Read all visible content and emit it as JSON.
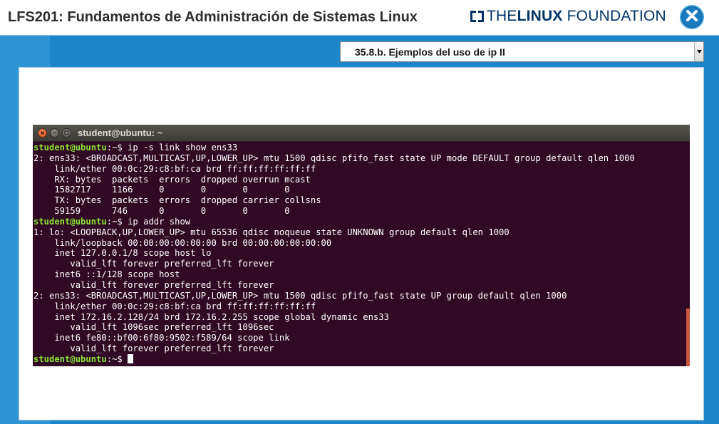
{
  "header": {
    "course_title": "LFS201: Fundamentos de Administración de Sistemas Linux",
    "logo": {
      "the": "THE",
      "linux": "LINUX",
      "foundation": "FOUNDATION",
      "icon": "lf-logo-mark"
    },
    "close_icon": "close-x-icon"
  },
  "navigation": {
    "section_select_value": "35.8.b. Ejemplos del uso de ip II"
  },
  "terminal": {
    "window_title": "student@ubuntu: ~",
    "lines": [
      {
        "prompt": "student@ubuntu",
        "path": ":~$ ",
        "text": "ip -s link show ens33"
      },
      {
        "text": "2: ens33: <BROADCAST,MULTICAST,UP,LOWER_UP> mtu 1500 qdisc pfifo_fast state UP mode DEFAULT group default qlen 1000"
      },
      {
        "text": "    link/ether 00:0c:29:c8:bf:ca brd ff:ff:ff:ff:ff:ff"
      },
      {
        "text": "    RX: bytes  packets  errors  dropped overrun mcast"
      },
      {
        "text": "    1582717    1166     0       0       0       0"
      },
      {
        "text": "    TX: bytes  packets  errors  dropped carrier collsns"
      },
      {
        "text": "    59159      746      0       0       0       0"
      },
      {
        "prompt": "student@ubuntu",
        "path": ":~$ ",
        "text": "ip addr show"
      },
      {
        "text": "1: lo: <LOOPBACK,UP,LOWER_UP> mtu 65536 qdisc noqueue state UNKNOWN group default qlen 1000"
      },
      {
        "text": "    link/loopback 00:00:00:00:00:00 brd 00:00:00:00:00:00"
      },
      {
        "text": "    inet 127.0.0.1/8 scope host lo"
      },
      {
        "text": "       valid_lft forever preferred_lft forever"
      },
      {
        "text": "    inet6 ::1/128 scope host"
      },
      {
        "text": "       valid_lft forever preferred_lft forever"
      },
      {
        "text": "2: ens33: <BROADCAST,MULTICAST,UP,LOWER_UP> mtu 1500 qdisc pfifo_fast state UP group default qlen 1000"
      },
      {
        "text": "    link/ether 00:0c:29:c8:bf:ca brd ff:ff:ff:ff:ff:ff"
      },
      {
        "text": "    inet 172.16.2.128/24 brd 172.16.2.255 scope global dynamic ens33"
      },
      {
        "text": "       valid_lft 1096sec preferred_lft 1096sec"
      },
      {
        "text": "    inet6 fe80::bf00:6f80:9502:f589/64 scope link"
      },
      {
        "text": "       valid_lft forever preferred_lft forever"
      },
      {
        "prompt": "student@ubuntu",
        "path": ":~$ ",
        "text": "",
        "cursor": true
      }
    ]
  },
  "colors": {
    "brand_blue": "#1c86c9",
    "terminal_bg": "#300a24",
    "prompt_green": "#8ae234",
    "logo_navy": "#003366"
  }
}
